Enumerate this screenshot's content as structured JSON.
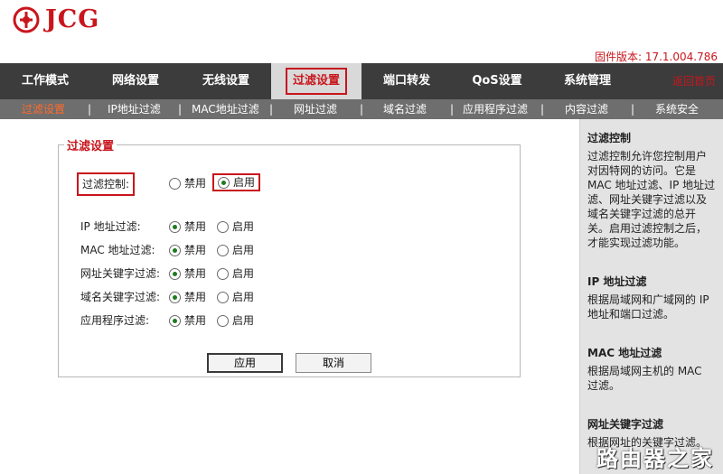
{
  "brand": {
    "logo_text": "JCG",
    "brand_color": "#c8161d"
  },
  "firmware": "固件版本: 17.1.004.786",
  "nav": {
    "items": [
      {
        "label": "工作模式"
      },
      {
        "label": "网络设置"
      },
      {
        "label": "无线设置"
      },
      {
        "label": "过滤设置",
        "active": true
      },
      {
        "label": "端口转发"
      },
      {
        "label": "QoS设置"
      },
      {
        "label": "系统管理"
      }
    ],
    "home": "返回首页"
  },
  "subnav": {
    "items": [
      {
        "label": "过滤设置",
        "active": true
      },
      {
        "label": "IP地址过滤"
      },
      {
        "label": "MAC地址过滤"
      },
      {
        "label": "网址过滤"
      },
      {
        "label": "域名过滤"
      },
      {
        "label": "应用程序过滤"
      },
      {
        "label": "内容过滤"
      },
      {
        "label": "系统安全"
      }
    ],
    "separator": "|"
  },
  "panel": {
    "title": "过滤设置",
    "master": {
      "label": "过滤控制:",
      "off": "禁用",
      "on": "启用",
      "selected": "on"
    },
    "rows": [
      {
        "label": "IP 地址过滤:",
        "off": "禁用",
        "on": "启用",
        "selected": "off"
      },
      {
        "label": "MAC 地址过滤:",
        "off": "禁用",
        "on": "启用",
        "selected": "off"
      },
      {
        "label": "网址关键字过滤:",
        "off": "禁用",
        "on": "启用",
        "selected": "off"
      },
      {
        "label": "域名关键字过滤:",
        "off": "禁用",
        "on": "启用",
        "selected": "off"
      },
      {
        "label": "应用程序过滤:",
        "off": "禁用",
        "on": "启用",
        "selected": "off"
      }
    ],
    "apply": "应用",
    "cancel": "取消"
  },
  "help": {
    "sections": [
      {
        "title": "过滤控制",
        "text": "过滤控制允许您控制用户对因特网的访问。它是MAC 地址过滤、IP 地址过滤、网址关键字过滤以及域名关键字过滤的总开关。启用过滤控制之后，才能实现过滤功能。"
      },
      {
        "title": "IP 地址过滤",
        "text": "根据局域网和广域网的 IP 地址和端口过滤。"
      },
      {
        "title": "MAC 地址过滤",
        "text": "根据局域网主机的 MAC 过滤。"
      },
      {
        "title": "网址关键字过滤",
        "text": "根据网址的关键字过滤。"
      }
    ],
    "watermark": "路由器之家"
  },
  "icons": {
    "logo": "jcg-logo-icon",
    "radio": "radio-icon"
  }
}
